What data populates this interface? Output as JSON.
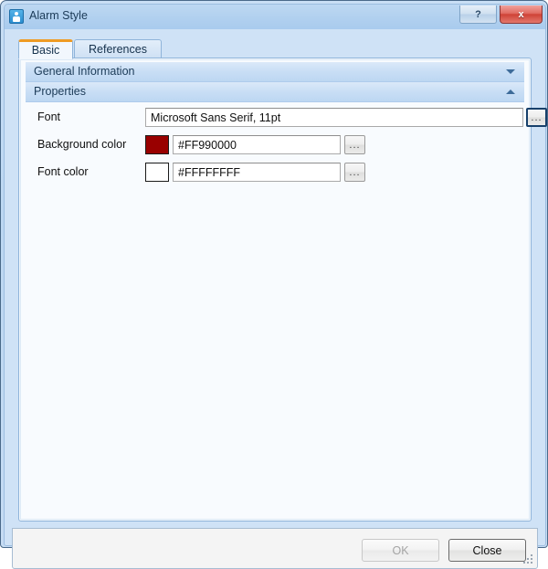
{
  "window": {
    "title": "Alarm Style",
    "icon": "alarm-style-icon",
    "controls": {
      "help_label": "?",
      "close_label": "x"
    }
  },
  "tabs": [
    {
      "label": "Basic",
      "selected": true
    },
    {
      "label": "References",
      "selected": false
    }
  ],
  "sections": [
    {
      "label": "General Information",
      "expanded": false,
      "chevron": "chevron-down-icon"
    },
    {
      "label": "Properties",
      "expanded": true,
      "chevron": "chevron-up-icon"
    }
  ],
  "properties": [
    {
      "label": "Font",
      "value": "Microsoft Sans Serif, 11pt",
      "browse_label": "...",
      "has_swatch": false,
      "focused": true
    },
    {
      "label": "Background color",
      "value": "#FF990000",
      "browse_label": "...",
      "has_swatch": true,
      "swatch_color": "#990000",
      "focused": false
    },
    {
      "label": "Font color",
      "value": "#FFFFFFFF",
      "browse_label": "...",
      "has_swatch": true,
      "swatch_color": "#FFFFFF",
      "focused": false
    }
  ],
  "footer": {
    "ok_label": "OK",
    "ok_enabled": false,
    "close_label": "Close",
    "close_enabled": true,
    "resize_grip": "resize-grip-icon"
  },
  "theme": {
    "titlebar_blue": "#aed0f0",
    "accent_orange": "#ef9b24",
    "close_red": "#cf4237",
    "section_blue": "#c8deF5"
  }
}
